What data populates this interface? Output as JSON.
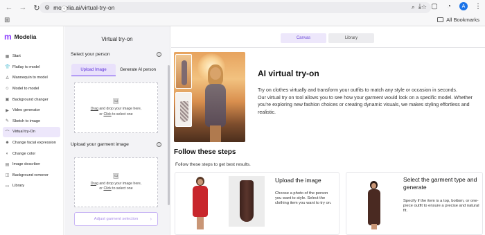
{
  "browser": {
    "url_domain": "modelia.ai",
    "url_path": "/virtual-try-on",
    "profile_initial": "A",
    "all_bookmarks_label": "All Bookmarks"
  },
  "sidebar": {
    "brand": "Modelia",
    "items": [
      {
        "label": "Start",
        "icon": "grid-icon"
      },
      {
        "label": "Flatlay to model",
        "icon": "shirt-icon"
      },
      {
        "label": "Mannequin to model",
        "icon": "mannequin-icon"
      },
      {
        "label": "Model to model",
        "icon": "person-icon"
      },
      {
        "label": "Background changer",
        "icon": "image-icon"
      },
      {
        "label": "Video generator",
        "icon": "video-icon"
      },
      {
        "label": "Sketch to image",
        "icon": "pencil-icon"
      },
      {
        "label": "Virtual try-On",
        "icon": "hanger-icon",
        "active": true
      },
      {
        "label": "Change facial expression",
        "icon": "face-icon"
      },
      {
        "label": "Change color",
        "icon": "palette-icon"
      },
      {
        "label": "Image describer",
        "icon": "document-icon"
      },
      {
        "label": "Background remover",
        "icon": "eraser-icon"
      },
      {
        "label": "Library",
        "icon": "folder-icon"
      }
    ]
  },
  "panel": {
    "title": "Virtual try-on",
    "person_section": "Select your person",
    "tab_upload": "Upload Image",
    "tab_generate": "Generate AI person",
    "dropzone_line1_link": "Drag",
    "dropzone_line1_rest": " and drop your image here,",
    "dropzone_line2_pre": "or ",
    "dropzone_line2_link": "Click",
    "dropzone_line2_rest": " to select one",
    "garment_section": "Upload your garment image",
    "adjust_button": "Adjust garment selection"
  },
  "main": {
    "tab_canvas": "Canvas",
    "tab_library": "Library",
    "hero_title": "AI virtual try-on",
    "hero_paragraph1": "Try on clothes virtually and transform your outfits to match any style or occasion in seconds.",
    "hero_paragraph2": "Our virtual try on tool allows you to see how your garment would look on a specific model. Whether you're exploring new fashion choices or creating dynamic visuals, we makes styling effortless and realistic.",
    "steps_title": "Follow these steps",
    "steps_subtitle": "Follow these steps to get best results.",
    "step1_title": "Upload the image",
    "step1_desc": "Choose a photo of the person you want to style. Select the clothing item you want to try on.",
    "step2_title": "Select the garment type and generate",
    "step2_desc": "Specify if the item is a top, bottom, or one-piece outfit to ensure a precise and natural fit."
  },
  "colors": {
    "accent": "#6b3df0",
    "accent_light": "#ede7fb",
    "panel_bg": "#f3f3f6"
  }
}
